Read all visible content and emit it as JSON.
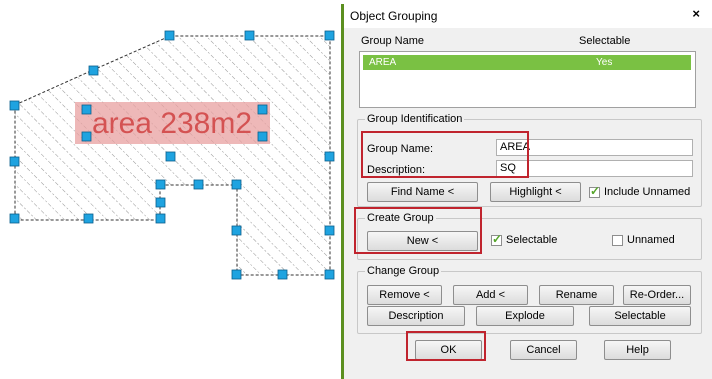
{
  "drawing": {
    "area_label": "area 238m2"
  },
  "dialog": {
    "title": "Object Grouping",
    "close_glyph": "×",
    "list": {
      "col_name": "Group Name",
      "col_selectable": "Selectable",
      "rows": [
        {
          "name": "AREA",
          "selectable": "Yes"
        }
      ]
    },
    "identification": {
      "heading": "Group Identification",
      "name_label": "Group Name:",
      "name_value": "AREA",
      "desc_label": "Description:",
      "desc_value": "SQ",
      "find_name": "Find Name <",
      "highlight": "Highlight <",
      "include_unnamed": "Include Unnamed",
      "include_unnamed_checked": true
    },
    "create": {
      "heading": "Create Group",
      "new": "New <",
      "selectable": "Selectable",
      "selectable_checked": true,
      "unnamed": "Unnamed",
      "unnamed_checked": false
    },
    "change": {
      "heading": "Change Group",
      "remove": "Remove <",
      "add": "Add <",
      "rename": "Rename",
      "reorder": "Re-Order...",
      "description": "Description",
      "explode": "Explode",
      "selectable": "Selectable"
    },
    "footer": {
      "ok": "OK",
      "cancel": "Cancel",
      "help": "Help"
    }
  },
  "colors": {
    "accent_green": "#7ac143",
    "highlight_red": "#c0242e",
    "grip_blue": "#1fa3e0"
  }
}
